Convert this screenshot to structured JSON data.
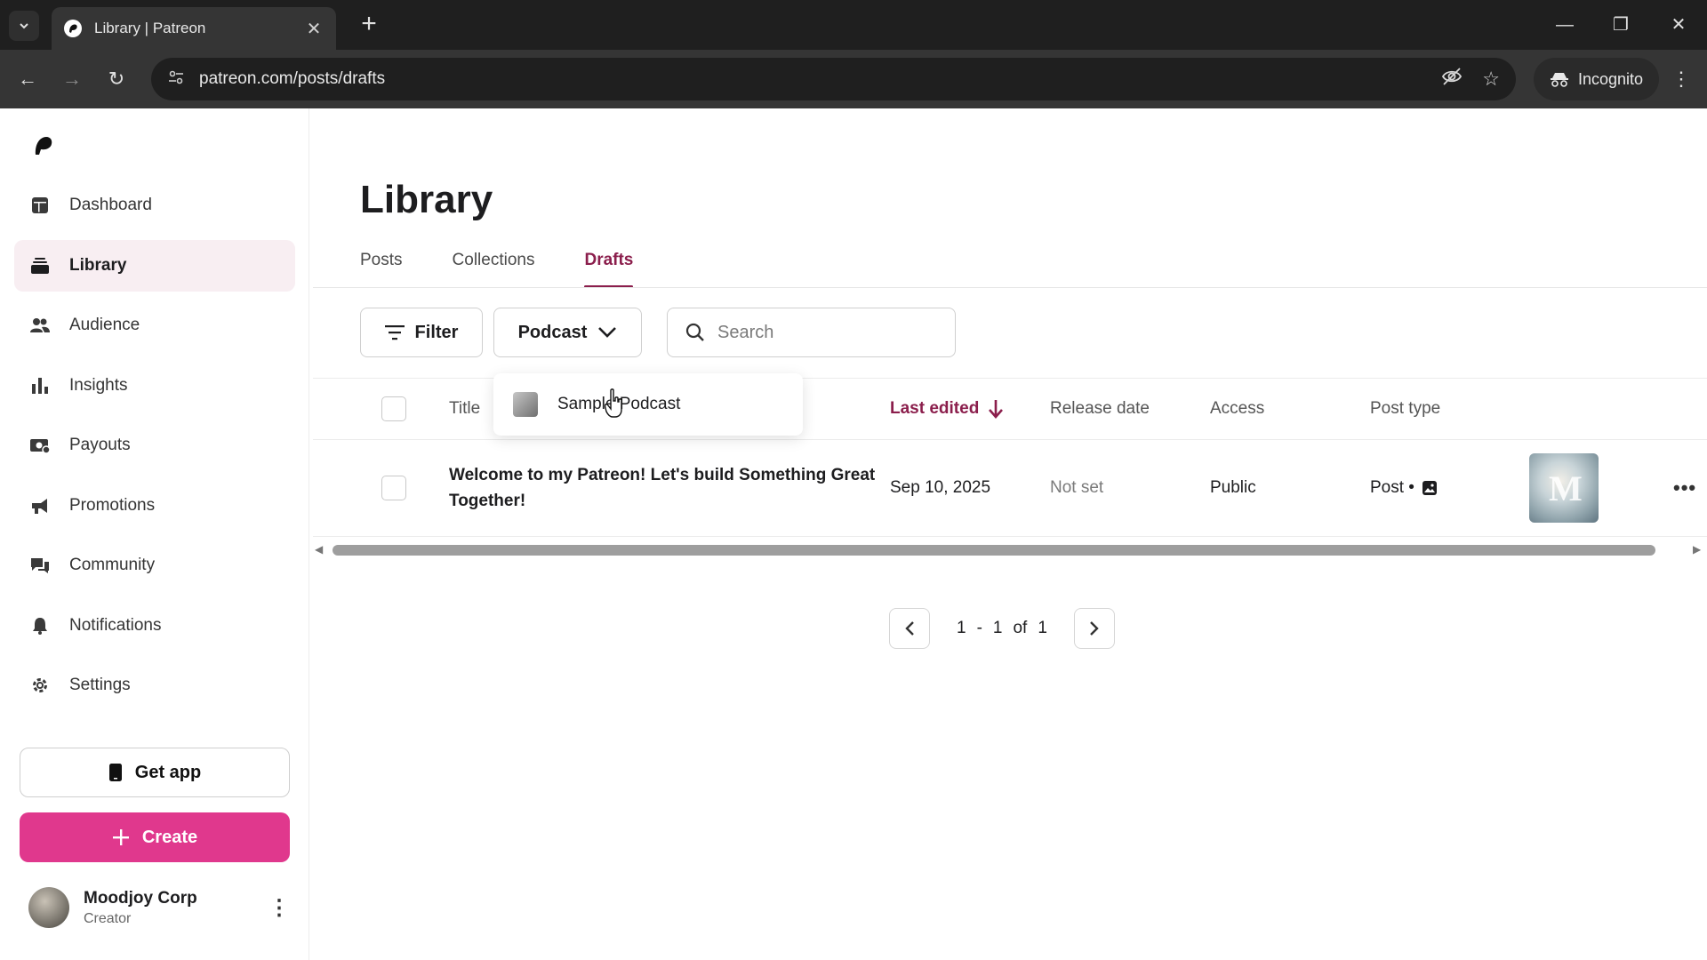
{
  "browser": {
    "tab_title": "Library | Patreon",
    "url": "patreon.com/posts/drafts",
    "incognito_label": "Incognito"
  },
  "sidebar": {
    "items": [
      {
        "label": "Dashboard",
        "icon": "dashboard-icon"
      },
      {
        "label": "Library",
        "icon": "library-icon",
        "active": true
      },
      {
        "label": "Audience",
        "icon": "audience-icon"
      },
      {
        "label": "Insights",
        "icon": "insights-icon"
      },
      {
        "label": "Payouts",
        "icon": "payouts-icon"
      },
      {
        "label": "Promotions",
        "icon": "promotions-icon"
      },
      {
        "label": "Community",
        "icon": "community-icon"
      },
      {
        "label": "Notifications",
        "icon": "bell-icon"
      },
      {
        "label": "Settings",
        "icon": "gear-icon"
      }
    ],
    "get_app_label": "Get app",
    "create_label": "Create",
    "profile": {
      "name": "Moodjoy Corp",
      "role": "Creator"
    }
  },
  "main": {
    "title": "Library",
    "tabs": [
      {
        "label": "Posts"
      },
      {
        "label": "Collections"
      },
      {
        "label": "Drafts",
        "active": true
      }
    ],
    "filter_label": "Filter",
    "collection_select": "Podcast",
    "search_placeholder": "Search",
    "dropdown": {
      "items": [
        {
          "label": "Sample Podcast"
        }
      ]
    },
    "table": {
      "columns": [
        "Title",
        "Last edited",
        "Release date",
        "Access",
        "Post type"
      ],
      "rows": [
        {
          "title": "Welcome to my Patreon! Let's build Something Great Together!",
          "last_edited": "Sep 10, 2025",
          "release_date": "Not set",
          "access": "Public",
          "post_type": "Post •"
        }
      ]
    },
    "pagination": {
      "start": "1",
      "separator": "-",
      "end": "1",
      "of_label": "of",
      "total": "1"
    }
  },
  "colors": {
    "accent": "#8b1e4c",
    "create": "#e0388d",
    "active_bg": "#f8eef2"
  }
}
